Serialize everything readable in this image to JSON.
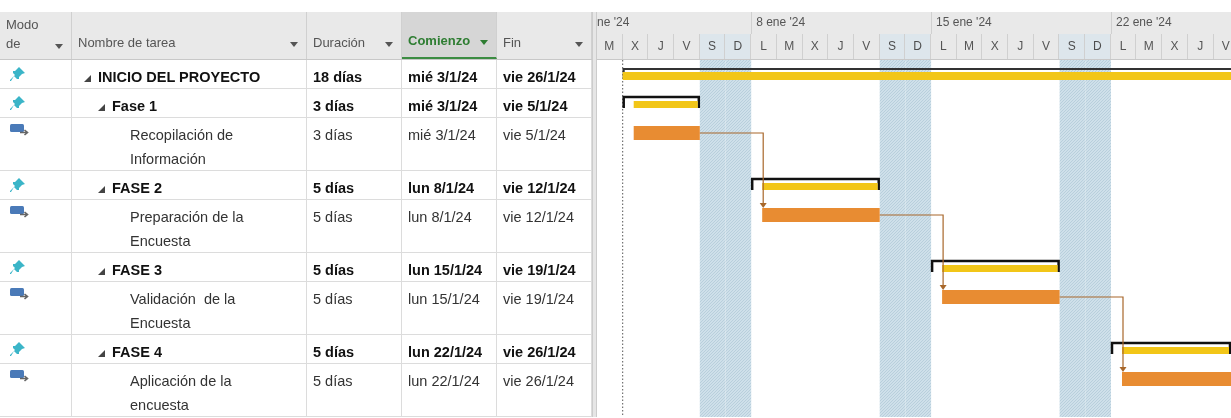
{
  "columns": [
    {
      "label": "Modo de",
      "selected": false
    },
    {
      "label": "Nombre de tarea",
      "selected": false
    },
    {
      "label": "Duración",
      "selected": false
    },
    {
      "label": "Comienzo",
      "selected": true
    },
    {
      "label": "Fin",
      "selected": false
    }
  ],
  "timeline": [
    {
      "label": "ne '24",
      "days": [
        {
          "label": "M",
          "weekend": false
        },
        {
          "label": "X",
          "weekend": false
        },
        {
          "label": "J",
          "weekend": false
        },
        {
          "label": "V",
          "weekend": false
        },
        {
          "label": "S",
          "weekend": true
        },
        {
          "label": "D",
          "weekend": true
        }
      ]
    },
    {
      "label": "8 ene '24",
      "days": [
        {
          "label": "L",
          "weekend": false
        },
        {
          "label": "M",
          "weekend": false
        },
        {
          "label": "X",
          "weekend": false
        },
        {
          "label": "J",
          "weekend": false
        },
        {
          "label": "V",
          "weekend": false
        },
        {
          "label": "S",
          "weekend": true
        },
        {
          "label": "D",
          "weekend": true
        }
      ]
    },
    {
      "label": "15 ene '24",
      "days": [
        {
          "label": "L",
          "weekend": false
        },
        {
          "label": "M",
          "weekend": false
        },
        {
          "label": "X",
          "weekend": false
        },
        {
          "label": "J",
          "weekend": false
        },
        {
          "label": "V",
          "weekend": false
        },
        {
          "label": "S",
          "weekend": true
        },
        {
          "label": "D",
          "weekend": true
        }
      ]
    },
    {
      "label": "22 ene '24",
      "days": [
        {
          "label": "L",
          "weekend": false
        },
        {
          "label": "M",
          "weekend": false
        },
        {
          "label": "X",
          "weekend": false
        },
        {
          "label": "J",
          "weekend": false
        },
        {
          "label": "V",
          "weekend": false
        }
      ]
    }
  ],
  "tasks": [
    {
      "kind": "summary",
      "name": "INICIO DEL PROYECTO",
      "duration": "18 días",
      "start": "mié 3/1/24",
      "finish": "vie 26/1/24",
      "expanded": true,
      "children": [
        {
          "kind": "summary",
          "name": "Fase 1",
          "duration": "3 días",
          "start": "mié 3/1/24",
          "finish": "vie 5/1/24",
          "expanded": true,
          "children": [
            {
              "kind": "task",
              "name": "Recopilación de Información",
              "duration": "3 días",
              "start": "mié 3/1/24",
              "finish": "vie 5/1/24"
            }
          ]
        },
        {
          "kind": "summary",
          "name": "FASE 2",
          "duration": "5 días",
          "start": "lun 8/1/24",
          "finish": "vie 12/1/24",
          "expanded": true,
          "children": [
            {
              "kind": "task",
              "name": "Preparación de la Encuesta",
              "duration": "5 días",
              "start": "lun 8/1/24",
              "finish": "vie 12/1/24"
            }
          ]
        },
        {
          "kind": "summary",
          "name": "FASE 3",
          "duration": "5 días",
          "start": "lun 15/1/24",
          "finish": "vie 19/1/24",
          "expanded": true,
          "children": [
            {
              "kind": "task",
              "name": "Validación  de la Encuesta",
              "duration": "5 días",
              "start": "lun 15/1/24",
              "finish": "vie 19/1/24"
            }
          ]
        },
        {
          "kind": "summary",
          "name": "FASE 4",
          "duration": "5 días",
          "start": "lun 22/1/24",
          "finish": "vie 26/1/24",
          "expanded": true,
          "children": [
            {
              "kind": "task",
              "name": "Aplicación de la encuesta",
              "duration": "5 días",
              "start": "lun 22/1/24",
              "finish": "vie 26/1/24"
            }
          ]
        }
      ]
    }
  ]
}
